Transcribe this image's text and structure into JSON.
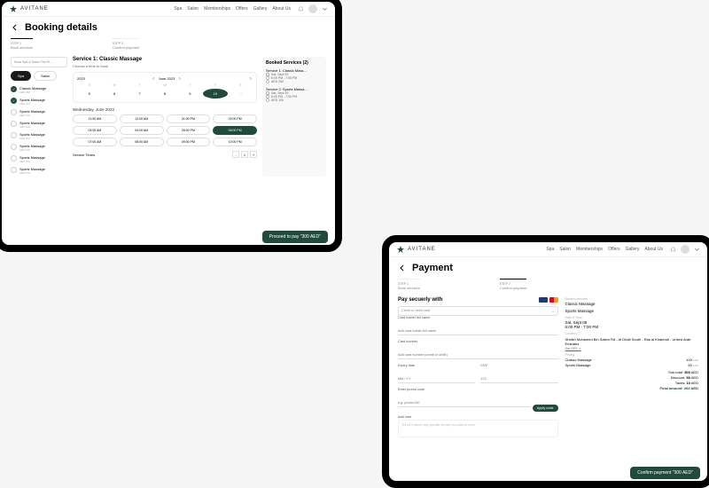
{
  "brand": "AVITANE",
  "nav": [
    "Spa",
    "Salon",
    "Memberships",
    "Offers",
    "Gallery",
    "About Us"
  ],
  "booking": {
    "title": "Booking details",
    "steps": [
      {
        "n": "STEP 1",
        "l": "Book services"
      },
      {
        "n": "STEP 2",
        "l": "Confirm payment"
      }
    ],
    "dropdown": "Nova Spa & Salon The Ri...",
    "tabs": [
      "Spa",
      "Salon"
    ],
    "services": [
      {
        "n": "Classic Massage",
        "p": "AED 450",
        "on": true
      },
      {
        "n": "Sports Massage",
        "p": "AED 100",
        "on": true
      },
      {
        "n": "Sports Massage",
        "p": "AED 100",
        "on": false
      },
      {
        "n": "Sports Massage",
        "p": "AED 100",
        "on": false
      },
      {
        "n": "Sports Massage",
        "p": "AED 100",
        "on": false
      },
      {
        "n": "Sports Massage",
        "p": "AED 100",
        "on": false
      },
      {
        "n": "Sports Massage",
        "p": "AED 100",
        "on": false
      },
      {
        "n": "Sports Massage",
        "p": "AED 100",
        "on": false
      }
    ],
    "serviceTitle": "Service 1: Classic Massage",
    "sub": "Choose a time to book",
    "year": "2023",
    "month": "June 2023",
    "days": [
      "S",
      "M",
      "T",
      "W",
      "T",
      "F",
      "S"
    ],
    "dates": [
      "5",
      "6",
      "7",
      "8",
      "9",
      "10",
      "11"
    ],
    "dateLabel": "Wednesday, June 2023",
    "slots": [
      "11:00 AM",
      "12:00 AM",
      "01:00 PM",
      "02:00 PM",
      "03:00 AM",
      "04:00 AM",
      "05:00 PM",
      "06:00 PM",
      "07:00 AM",
      "08:00 AM",
      "09:00 PM",
      "10:00 PM"
    ],
    "slotOn": 7,
    "serviceTimes": "Service Times",
    "qty": "1",
    "booked": {
      "title": "Booked Services (2)",
      "items": [
        {
          "n": "Service 1: Classic Mass...",
          "d": "Sat, Sept 09",
          "t": "6:00 PM - 7:00 PM",
          "p": "AED 200"
        },
        {
          "n": "Service 2: Sports Massa...",
          "d": "Sat, Sept 09",
          "t": "6:00 PM - 7:00 PM",
          "p": "AED 100"
        }
      ]
    },
    "cta": "Proceed to pay \"300 AED\""
  },
  "payment": {
    "title": "Payment",
    "payWith": "Pay secuerly with",
    "cardSel": "Credit or debit card",
    "fields": {
      "holder": {
        "l": "Card holder full name",
        "p": "Add card holder full name"
      },
      "number": {
        "l": "Card number",
        "p": "Add card number (credit or debit)"
      },
      "exp": {
        "l": "Expiry date",
        "p": "MM / YY"
      },
      "cvv": {
        "l": "CVV",
        "p": "123"
      }
    },
    "promo": {
      "l": "Enter promo code",
      "p": "e.g. promo100",
      "btn": "Apply code"
    },
    "note": {
      "l": "Add note",
      "p": "Tell us if there's any specific service you want to have"
    },
    "summary": {
      "bookedL": "Booked services",
      "s1": "Classic Massage",
      "s2": "Sports Massage",
      "dtL": "Date & Time",
      "date": "Sat, Sept 09",
      "time": "6:00 PM - 7:00 PM",
      "locL": "Location ⓘ",
      "loc": "Sheikh Mohamed Bin Salem Rd - Al Dhait South - Ras al Khaimah - United Arab Emirates",
      "gps": "Get GPS ↗",
      "priceL": "Pricing",
      "lines": [
        {
          "n": "Classic Massage",
          "a": "100",
          "c": "AED"
        },
        {
          "n": "Sports Massage",
          "a": "50",
          "c": "AED"
        }
      ],
      "totals": [
        {
          "l": "Sub total:",
          "a": "300",
          "c": "AED"
        },
        {
          "l": "Discount:",
          "a": "50",
          "c": "AED"
        },
        {
          "l": "Taxes:",
          "a": "10",
          "c": "AED"
        },
        {
          "l": "Final amount:",
          "a": "260",
          "c": "AED",
          "fa": true
        }
      ]
    },
    "cta": "Confirm payment \"300 AED\""
  }
}
